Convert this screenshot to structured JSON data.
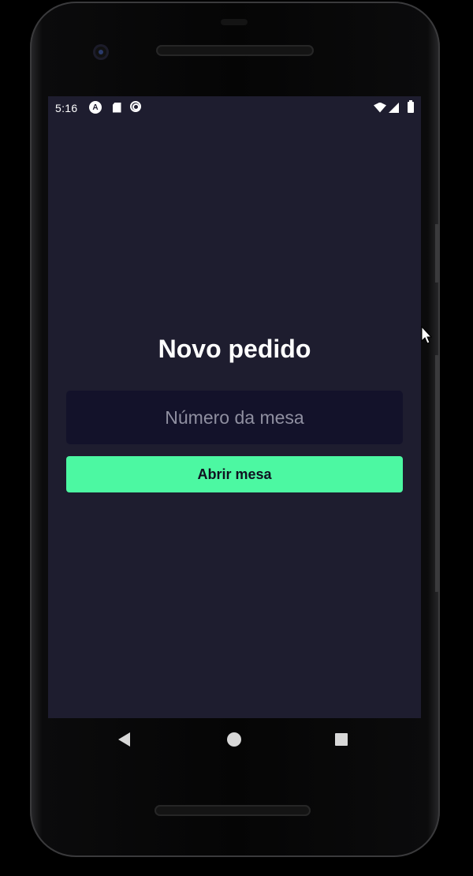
{
  "status_bar": {
    "time": "5:16",
    "left_icons": [
      "expo-a-icon",
      "sd-card-icon",
      "sync-icon"
    ],
    "right_icons": [
      "wifi-icon",
      "signal-icon",
      "battery-icon"
    ]
  },
  "app": {
    "title": "Novo pedido",
    "table_input": {
      "value": "",
      "placeholder": "Número da mesa"
    },
    "open_button_label": "Abrir mesa"
  },
  "nav_bar": {
    "buttons": [
      "back",
      "home",
      "recents"
    ]
  },
  "colors": {
    "background": "#1e1d2f",
    "input_background": "#13122a",
    "accent": "#4cf8a2",
    "title_text": "#ffffff",
    "placeholder_text": "#8f8fa0"
  }
}
